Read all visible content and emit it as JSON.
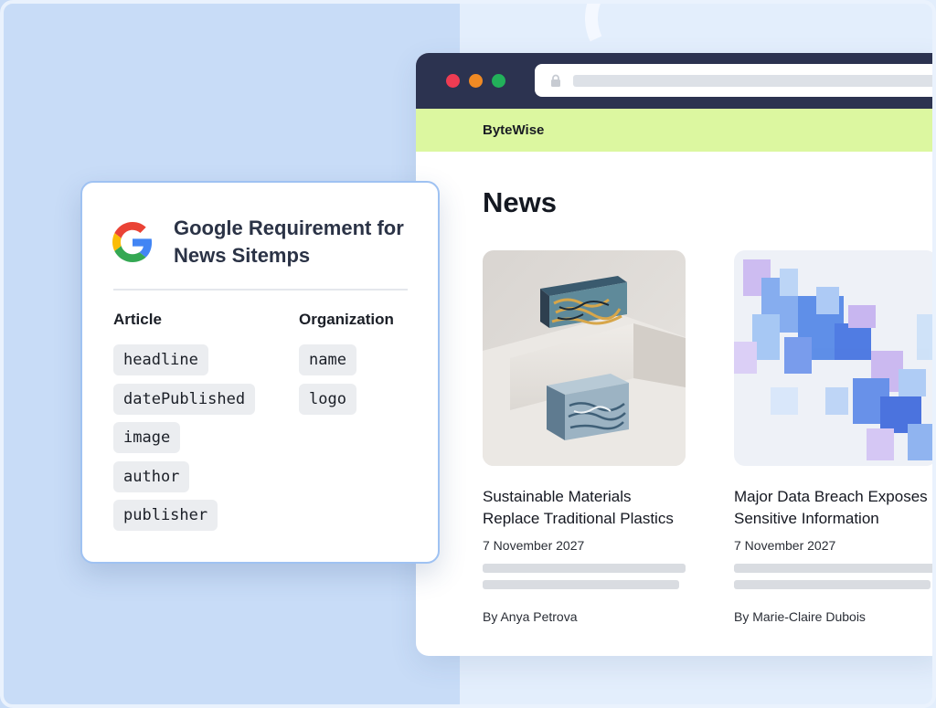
{
  "panel": {
    "title": "Google Requirement for News Sitemps",
    "icon": "google-g-icon",
    "article_heading": "Article",
    "organization_heading": "Organization",
    "article_fields": [
      "headline",
      "datePublished",
      "image",
      "author",
      "publisher"
    ],
    "organization_fields": [
      "name",
      "logo"
    ]
  },
  "browser": {
    "traffic_lights": [
      "#ee3c53",
      "#f08a24",
      "#22b15a"
    ],
    "site_name": "ByteWise",
    "header_color": "#dcf7a0",
    "page_title": "News",
    "articles": [
      {
        "title_line1": "Sustainable Materials",
        "title_line2": "Replace Traditional Plastics",
        "date": "7 November 2027",
        "author": "By Anya Petrova"
      },
      {
        "title_line1": "Major Data Breach Exposes",
        "title_line2": "Sensitive Information",
        "date": "7 November 2027",
        "author": "By Marie-Claire Dubois"
      }
    ]
  }
}
